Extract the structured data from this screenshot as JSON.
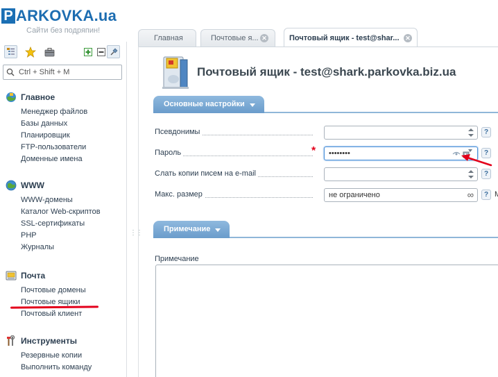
{
  "logo": {
    "brand": "ARKOVKA",
    "brand_first": "P",
    "tld": ".ua",
    "tagline": "Сайти без подряпин!"
  },
  "sidebar": {
    "search_placeholder": "Ctrl + Shift + M",
    "sections": [
      {
        "title": "Главное",
        "icon": "home-globe-icon",
        "items": [
          "Менеджер файлов",
          "Базы данных",
          "Планировщик",
          "FTP-пользователи",
          "Доменные имена"
        ]
      },
      {
        "title": "WWW",
        "icon": "www-globe-icon",
        "items": [
          "WWW-домены",
          "Каталог Web-скриптов",
          "SSL-сертификаты",
          "PHP",
          "Журналы"
        ]
      },
      {
        "title": "Почта",
        "icon": "mail-icon",
        "items": [
          "Почтовые домены",
          "Почтовые ящики",
          "Почтовый клиент"
        ],
        "active_item": "Почтовые ящики"
      },
      {
        "title": "Инструменты",
        "icon": "tools-icon",
        "items": [
          "Резервные копии",
          "Выполнить команду"
        ]
      }
    ]
  },
  "tabs": [
    {
      "label": "Главная"
    },
    {
      "label": "Почтовые я..."
    },
    {
      "label": "Почтовый ящик - test@shar..."
    }
  ],
  "page": {
    "title": "Почтовый ящик - test@shark.parkovka.biz.ua"
  },
  "main_settings": {
    "header": "Основные настройки",
    "fields": [
      {
        "label": "Псевдонимы",
        "value": ""
      },
      {
        "label": "Пароль",
        "value": "••••••••",
        "required": true
      },
      {
        "label": "Слать копии писем на e-mail",
        "value": ""
      },
      {
        "label": "Макс. размер",
        "value": "не ограничено",
        "suffix": "M"
      }
    ],
    "help_glyph": "?"
  },
  "note_section": {
    "header": "Примечание",
    "label": "Примечание",
    "value": ""
  },
  "colors": {
    "accent": "#6a9ccb",
    "brand": "#1d6db1",
    "required": "#e3001b",
    "annotation": "#e3001b"
  }
}
